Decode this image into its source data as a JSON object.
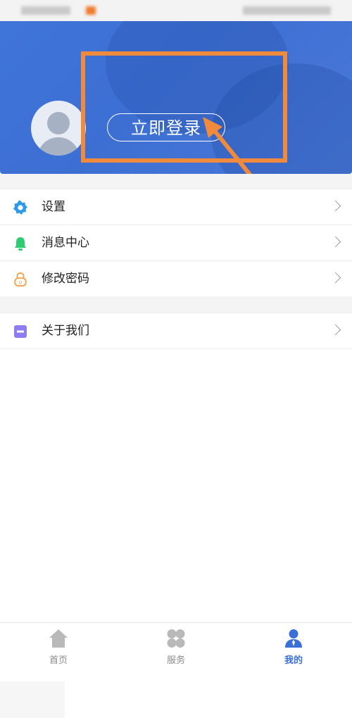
{
  "header": {
    "login_button_label": "立即登录"
  },
  "menu": {
    "section1": [
      {
        "label": "设置",
        "icon": "gear-icon"
      },
      {
        "label": "消息中心",
        "icon": "bell-icon"
      },
      {
        "label": "修改密码",
        "icon": "lock-icon"
      }
    ],
    "section2": [
      {
        "label": "关于我们",
        "icon": "about-icon"
      }
    ]
  },
  "bottom_nav": {
    "items": [
      {
        "label": "首页",
        "icon": "home-icon",
        "active": false
      },
      {
        "label": "服务",
        "icon": "services-icon",
        "active": false
      },
      {
        "label": "我的",
        "icon": "profile-icon",
        "active": true
      }
    ]
  },
  "colors": {
    "header_blue": "#3f74d8",
    "highlight_orange": "#f08a3c",
    "active_nav": "#3b6fd6",
    "gear_blue": "#2d9be8",
    "bell_green": "#2ecc71",
    "lock_orange": "#f0a246",
    "about_purple": "#8e7cf0"
  }
}
